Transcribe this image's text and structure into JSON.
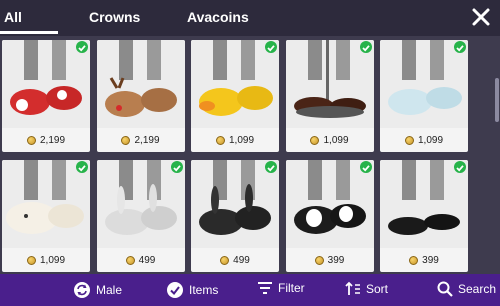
{
  "tabs": [
    {
      "label": "All",
      "active": true
    },
    {
      "label": "Crowns",
      "active": false
    },
    {
      "label": "Avacoins",
      "active": false
    }
  ],
  "close_icon": "close-icon",
  "items": [
    {
      "price": "2,199",
      "owned": true,
      "name": "santa-slippers"
    },
    {
      "price": "2,199",
      "owned": false,
      "name": "reindeer-slippers"
    },
    {
      "price": "1,099",
      "owned": true,
      "name": "duck-slippers"
    },
    {
      "price": "1,099",
      "owned": true,
      "name": "sandals"
    },
    {
      "price": "1,099",
      "owned": true,
      "name": "light-blue-slippers"
    },
    {
      "price": "1,099",
      "owned": true,
      "name": "sheep-slippers"
    },
    {
      "price": "499",
      "owned": true,
      "name": "white-bunny-slippers"
    },
    {
      "price": "499",
      "owned": true,
      "name": "black-bunny-slippers"
    },
    {
      "price": "399",
      "owned": true,
      "name": "ghost-slippers"
    },
    {
      "price": "399",
      "owned": true,
      "name": "black-loafers"
    }
  ],
  "bottom_bar": {
    "male": "Male",
    "items": "Items",
    "filter": "Filter",
    "sort": "Sort",
    "search": "Search"
  },
  "colors": {
    "accent": "#4a1f8c",
    "check": "#27b34a",
    "topbar": "#2d2a3c"
  }
}
